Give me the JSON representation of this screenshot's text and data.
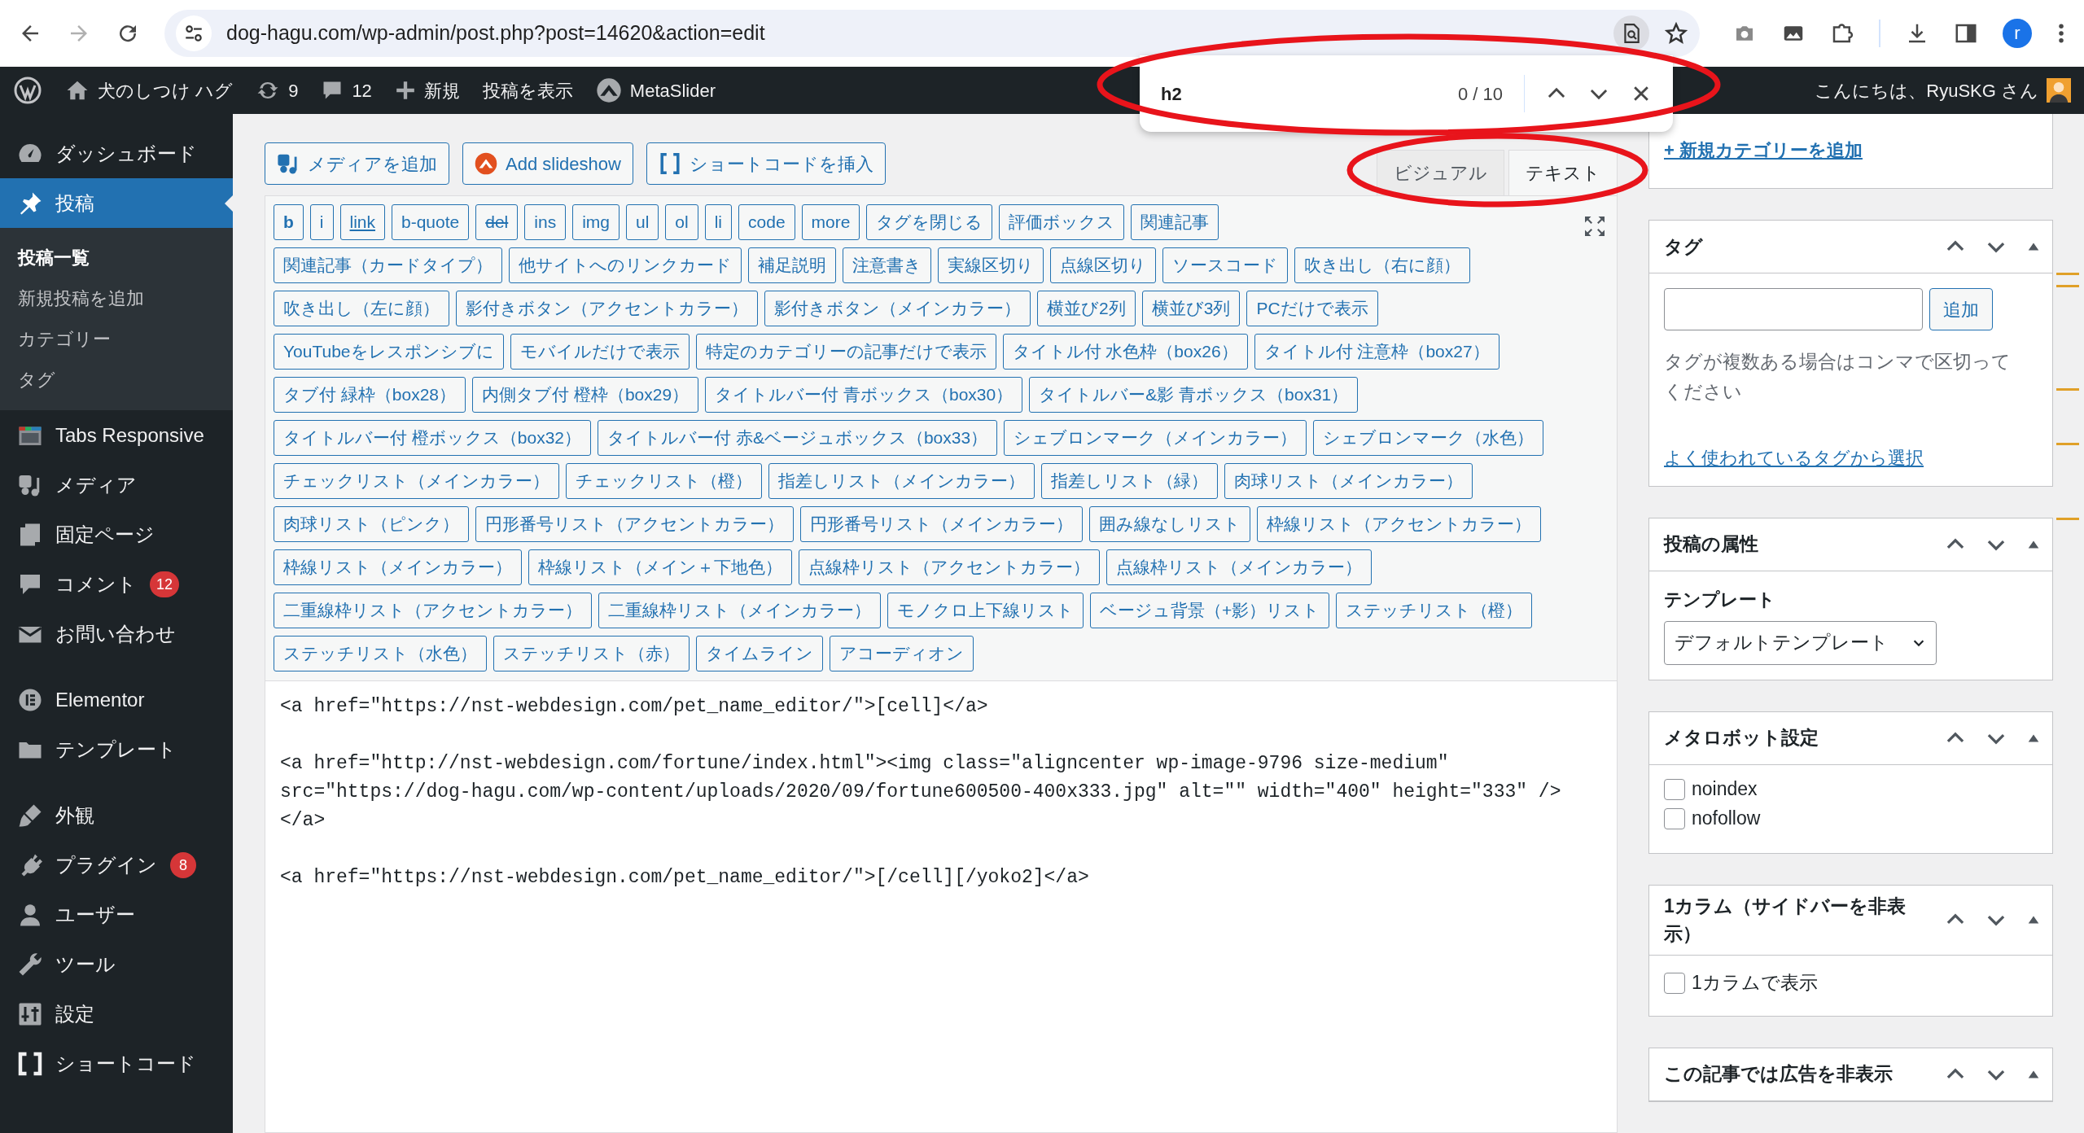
{
  "browser": {
    "address": "dog-hagu.com/wp-admin/post.php?post=14620&action=edit",
    "forward_disabled": true,
    "profile_initial": "r"
  },
  "find_bar": {
    "query": "h2",
    "count": "0 / 10",
    "highlighted": true
  },
  "admin_bar": {
    "site_name": "犬のしつけ ハグ",
    "updates": "9",
    "comments": "12",
    "new": "新規",
    "view_post": "投稿を表示",
    "metaslider": "MetaSlider",
    "greeting": "こんにちは、RyuSKG さん"
  },
  "sidebar": {
    "groups": [
      {
        "items": [
          {
            "label": "ダッシュボード",
            "selected": false
          },
          {
            "label": "投稿",
            "selected": true,
            "children": [
              {
                "label": "投稿一覧",
                "selected": true
              },
              {
                "label": "新規投稿を追加",
                "selected": false
              },
              {
                "label": "カテゴリー",
                "selected": false
              },
              {
                "label": "タグ",
                "selected": false
              }
            ]
          },
          {
            "label": "Tabs Responsive",
            "selected": false
          },
          {
            "label": "メディア",
            "selected": false
          },
          {
            "label": "固定ページ",
            "selected": false
          },
          {
            "label": "コメント",
            "selected": false,
            "badge": "12"
          },
          {
            "label": "お問い合わせ",
            "selected": false
          }
        ]
      },
      {
        "items": [
          {
            "label": "Elementor",
            "selected": false
          },
          {
            "label": "テンプレート",
            "selected": false
          }
        ]
      },
      {
        "items": [
          {
            "label": "外観",
            "selected": false
          },
          {
            "label": "プラグイン",
            "selected": false,
            "badge": "8"
          },
          {
            "label": "ユーザー",
            "selected": false
          },
          {
            "label": "ツール",
            "selected": false
          },
          {
            "label": "設定",
            "selected": false
          },
          {
            "label": "ショートコード",
            "selected": false
          }
        ]
      }
    ]
  },
  "editor": {
    "media_buttons": [
      "メディアを追加",
      "Add slideshow",
      "ショートコードを挿入"
    ],
    "tabs_highlighted": true,
    "tabs": [
      {
        "label": "ビジュアル",
        "selected": false
      },
      {
        "label": "テキスト",
        "selected": true
      }
    ],
    "toolbar_rows": [
      [
        {
          "label": "b",
          "kind": "bold"
        },
        {
          "label": "i",
          "kind": "plain"
        },
        {
          "label": "link",
          "kind": "underline"
        },
        {
          "label": "b-quote",
          "kind": "plain"
        },
        {
          "label": "del",
          "kind": "strike"
        },
        {
          "label": "ins",
          "kind": "plain"
        },
        {
          "label": "img",
          "kind": "plain"
        },
        {
          "label": "ul",
          "kind": "plain"
        },
        {
          "label": "ol",
          "kind": "plain"
        },
        {
          "label": "li",
          "kind": "plain"
        },
        {
          "label": "code",
          "kind": "plain"
        },
        {
          "label": "more",
          "kind": "plain"
        },
        {
          "label": "タグを閉じる",
          "kind": "plain"
        },
        {
          "label": "評価ボックス",
          "kind": "plain"
        },
        {
          "label": "関連記事",
          "kind": "plain"
        }
      ],
      [
        {
          "label": "関連記事（カードタイプ）",
          "kind": "plain"
        },
        {
          "label": "他サイトへのリンクカード",
          "kind": "plain"
        },
        {
          "label": "補足説明",
          "kind": "plain"
        },
        {
          "label": "注意書き",
          "kind": "plain"
        },
        {
          "label": "実線区切り",
          "kind": "plain"
        },
        {
          "label": "点線区切り",
          "kind": "plain"
        },
        {
          "label": "ソースコード",
          "kind": "plain"
        },
        {
          "label": "吹き出し（右に顔）",
          "kind": "plain"
        }
      ],
      [
        {
          "label": "吹き出し（左に顔）",
          "kind": "plain"
        },
        {
          "label": "影付きボタン（アクセントカラー）",
          "kind": "plain"
        },
        {
          "label": "影付きボタン（メインカラー）",
          "kind": "plain"
        },
        {
          "label": "横並び2列",
          "kind": "plain"
        },
        {
          "label": "横並び3列",
          "kind": "plain"
        },
        {
          "label": "PCだけで表示",
          "kind": "plain"
        }
      ],
      [
        {
          "label": "YouTubeをレスポンシブに",
          "kind": "plain"
        },
        {
          "label": "モバイルだけで表示",
          "kind": "plain"
        },
        {
          "label": "特定のカテゴリーの記事だけで表示",
          "kind": "plain"
        },
        {
          "label": "タイトル付 水色枠（box26）",
          "kind": "plain"
        },
        {
          "label": "タイトル付 注意枠（box27）",
          "kind": "plain"
        }
      ],
      [
        {
          "label": "タブ付 緑枠（box28）",
          "kind": "plain"
        },
        {
          "label": "内側タブ付 橙枠（box29）",
          "kind": "plain"
        },
        {
          "label": "タイトルバー付 青ボックス（box30）",
          "kind": "plain"
        },
        {
          "label": "タイトルバー&影 青ボックス（box31）",
          "kind": "plain"
        }
      ],
      [
        {
          "label": "タイトルバー付 橙ボックス（box32）",
          "kind": "plain"
        },
        {
          "label": "タイトルバー付 赤&ベージュボックス（box33）",
          "kind": "plain"
        },
        {
          "label": "シェブロンマーク（メインカラー）",
          "kind": "plain"
        },
        {
          "label": "シェブロンマーク（水色）",
          "kind": "plain"
        }
      ],
      [
        {
          "label": "チェックリスト（メインカラー）",
          "kind": "plain"
        },
        {
          "label": "チェックリスト（橙）",
          "kind": "plain"
        },
        {
          "label": "指差しリスト（メインカラー）",
          "kind": "plain"
        },
        {
          "label": "指差しリスト（緑）",
          "kind": "plain"
        },
        {
          "label": "肉球リスト（メインカラー）",
          "kind": "plain"
        }
      ],
      [
        {
          "label": "肉球リスト（ピンク）",
          "kind": "plain"
        },
        {
          "label": "円形番号リスト（アクセントカラー）",
          "kind": "plain"
        },
        {
          "label": "円形番号リスト（メインカラー）",
          "kind": "plain"
        },
        {
          "label": "囲み線なしリスト",
          "kind": "plain"
        },
        {
          "label": "枠線リスト（アクセントカラー）",
          "kind": "plain"
        }
      ],
      [
        {
          "label": "枠線リスト（メインカラー）",
          "kind": "plain"
        },
        {
          "label": "枠線リスト（メイン＋下地色）",
          "kind": "plain"
        },
        {
          "label": "点線枠リスト（アクセントカラー）",
          "kind": "plain"
        },
        {
          "label": "点線枠リスト（メインカラー）",
          "kind": "plain"
        }
      ],
      [
        {
          "label": "二重線枠リスト（アクセントカラー）",
          "kind": "plain"
        },
        {
          "label": "二重線枠リスト（メインカラー）",
          "kind": "plain"
        },
        {
          "label": "モノクロ上下線リスト",
          "kind": "plain"
        },
        {
          "label": "ベージュ背景（+影）リスト",
          "kind": "plain"
        },
        {
          "label": "ステッチリスト（橙）",
          "kind": "plain"
        }
      ],
      [
        {
          "label": "ステッチリスト（水色）",
          "kind": "plain"
        },
        {
          "label": "ステッチリスト（赤）",
          "kind": "plain"
        },
        {
          "label": "タイムライン",
          "kind": "plain"
        },
        {
          "label": "アコーディオン",
          "kind": "plain"
        }
      ]
    ],
    "paragraphs": [
      [
        "<a href=\"https://nst-webdesign.com/pet_name_editor/\">[cell]</a>"
      ],
      [
        "<a href=\"http://nst-webdesign.com/fortune/index.html\"><img class=\"aligncenter wp-image-9796 size-medium\"",
        "src=\"https://dog-hagu.com/wp-content/uploads/2020/09/fortune600500-400x333.jpg\" alt=\"\" width=\"400\" height=\"333\" />",
        "</a>"
      ],
      [
        "<a href=\"https://nst-webdesign.com/pet_name_editor/\">[/cell][/yoko2]</a>"
      ]
    ]
  },
  "side_boxes": [
    {
      "kind": "category_tail",
      "link": "+ 新規カテゴリーを追加"
    },
    {
      "kind": "tags",
      "title": "タグ",
      "add_button": "追加",
      "hint": "タグが複数ある場合はコンマで区切ってください",
      "link": "よく使われているタグから選択"
    },
    {
      "kind": "attributes",
      "title": "投稿の属性",
      "label": "テンプレート",
      "select": "デフォルトテンプレート"
    },
    {
      "kind": "checkboxes",
      "title": "メタロボット設定",
      "options": [
        {
          "label": "noindex",
          "checked": false
        },
        {
          "label": "nofollow",
          "checked": false
        }
      ]
    },
    {
      "kind": "checkboxes",
      "title": "1カラム（サイドバーを非表示）",
      "options": [
        {
          "label": "1カラムで表示",
          "checked": false
        }
      ]
    },
    {
      "kind": "header_only",
      "title": "この記事では広告を非表示"
    }
  ]
}
